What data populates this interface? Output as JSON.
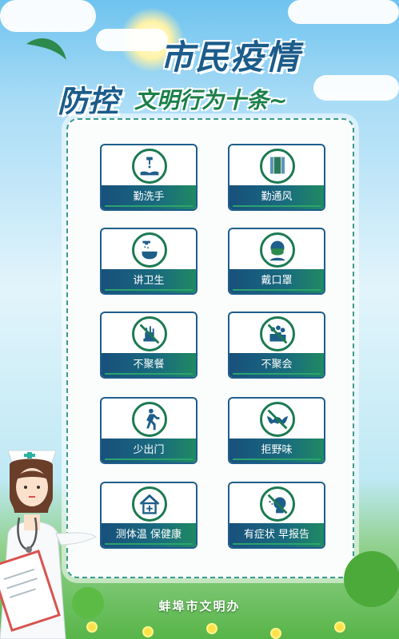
{
  "header": {
    "title_line1": "市民疫情",
    "title_line2_bold": "防控",
    "title_line2_rest": "文明行为十条~"
  },
  "items": [
    {
      "label": "勤洗手",
      "icon": "hand-wash-icon"
    },
    {
      "label": "勤通风",
      "icon": "ventilation-window-icon"
    },
    {
      "label": "讲卫生",
      "icon": "shower-icon"
    },
    {
      "label": "戴口罩",
      "icon": "face-mask-icon"
    },
    {
      "label": "不聚餐",
      "icon": "no-dining-icon"
    },
    {
      "label": "不聚会",
      "icon": "no-gathering-icon"
    },
    {
      "label": "少出门",
      "icon": "walking-person-icon"
    },
    {
      "label": "拒野味",
      "icon": "no-wild-animal-icon"
    },
    {
      "label": "测体温 保健康",
      "icon": "medical-house-icon"
    },
    {
      "label": "有症状 早报告",
      "icon": "cough-report-icon"
    }
  ],
  "footer": {
    "org": "蚌埠市文明办"
  },
  "colors": {
    "navy": "#17507c",
    "green": "#1b7a52",
    "sky": "#6fc3ef"
  }
}
